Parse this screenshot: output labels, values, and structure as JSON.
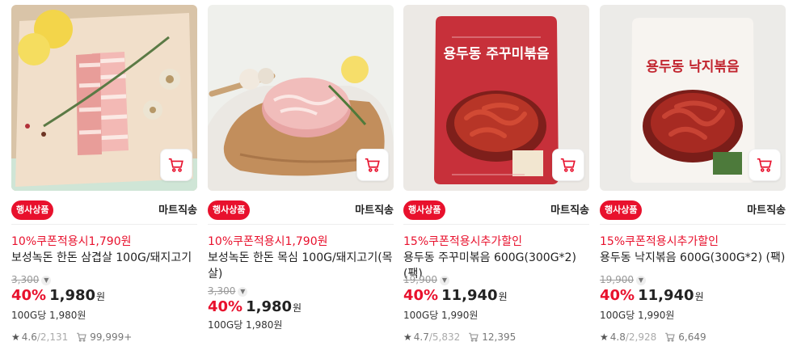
{
  "colors": {
    "accent": "#e8112d",
    "text": "#222222",
    "muted": "#999999"
  },
  "products": [
    {
      "badge": "행사상품",
      "shipping": "마트직송",
      "promo": "10%쿠폰적용시1,790원",
      "name": "보성녹돈 한돈 삼겹살 100G/돼지고기",
      "original_price": "3,300",
      "discount": "40%",
      "price": "1,980",
      "won": "원",
      "unit_price": "100G당 1,980원",
      "rating": "4.6",
      "review_count": "/2,131",
      "cart_count": "99,999+",
      "cart_icon": "shopping-cart-icon",
      "image_desc": "pork belly on butcher paper"
    },
    {
      "badge": "행사상품",
      "shipping": "마트직송",
      "promo": "10%쿠폰적용시1,790원",
      "name": "보성녹돈 한돈 목심 100G/돼지고기(목살)",
      "original_price": "3,300",
      "discount": "40%",
      "price": "1,980",
      "won": "원",
      "unit_price": "100G당 1,980원",
      "rating": "",
      "review_count": "",
      "cart_count": "",
      "cart_icon": "shopping-cart-icon",
      "image_desc": "pork neck on wooden board"
    },
    {
      "badge": "행사상품",
      "shipping": "마트직송",
      "promo": "15%쿠폰적용시추가할인",
      "name": "용두동 주꾸미볶음 600G(300G*2) (팩)",
      "original_price": "19,900",
      "discount": "40%",
      "price": "11,940",
      "won": "원",
      "unit_price": "100G당 1,990원",
      "rating": "4.7",
      "review_count": "/5,832",
      "cart_count": "12,395",
      "cart_icon": "shopping-cart-icon",
      "package_title": "용두동 주꾸미볶음",
      "image_desc": "red package spicy webfoot octopus"
    },
    {
      "badge": "행사상품",
      "shipping": "마트직송",
      "promo": "15%쿠폰적용시추가할인",
      "name": "용두동 낙지볶음 600G(300G*2) (팩)",
      "original_price": "19,900",
      "discount": "40%",
      "price": "11,940",
      "won": "원",
      "unit_price": "100G당 1,990원",
      "rating": "4.8",
      "review_count": "/2,928",
      "cart_count": "6,649",
      "cart_icon": "shopping-cart-icon",
      "package_title": "용두동 낙지볶음",
      "image_desc": "white package spicy octopus"
    }
  ]
}
